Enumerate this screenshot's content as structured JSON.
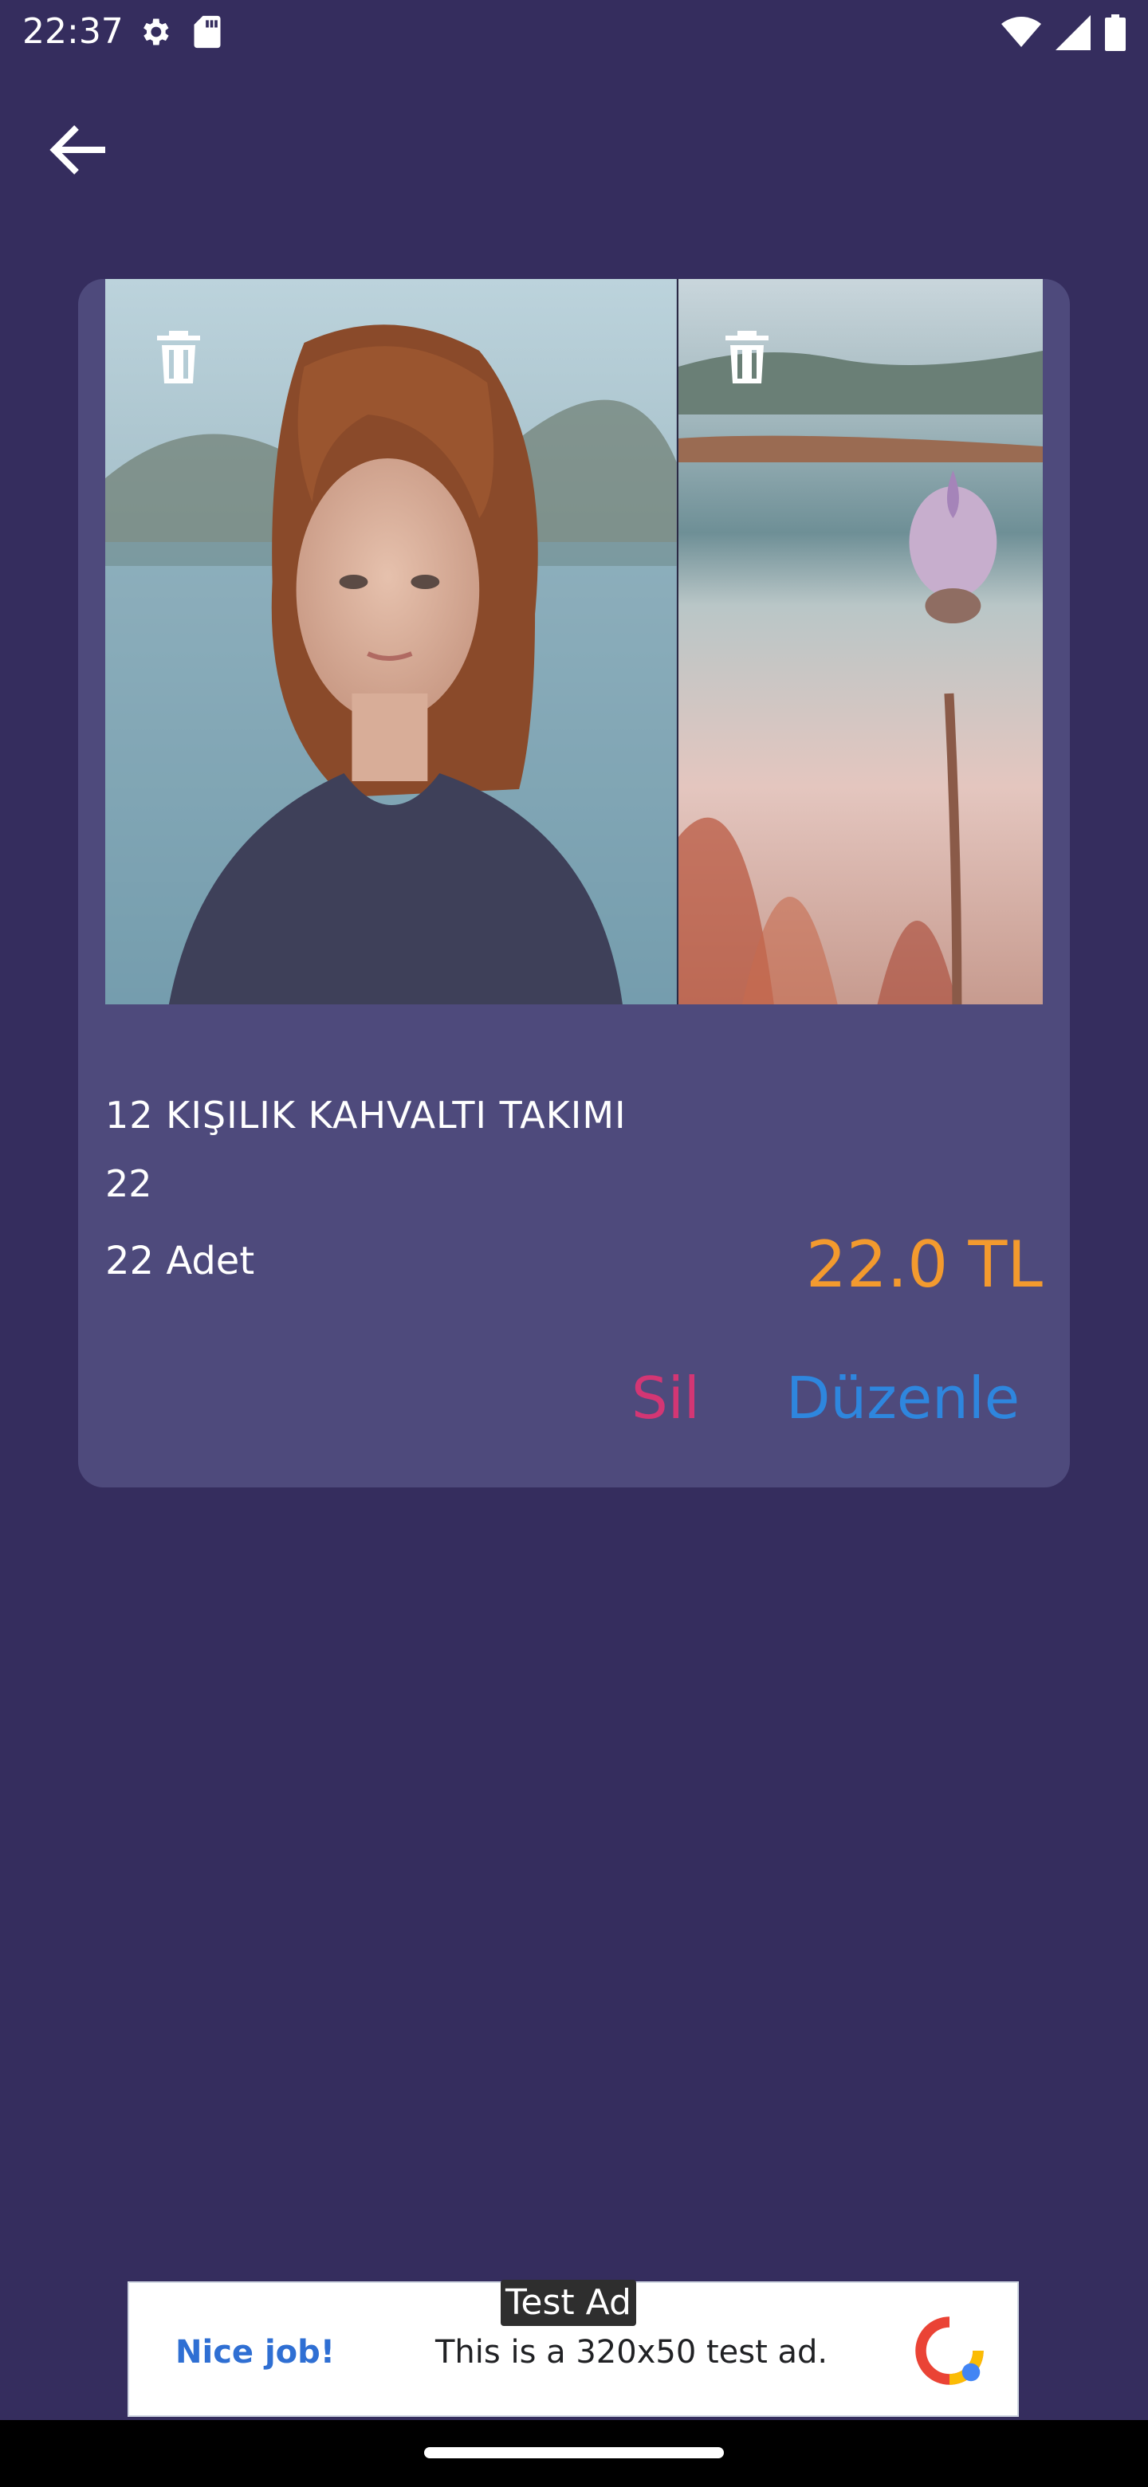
{
  "status_bar": {
    "time": "22:37",
    "left_icons": [
      "gear-icon",
      "sd-card-icon"
    ],
    "right_icons": [
      "wifi-icon",
      "signal-icon",
      "battery-icon"
    ]
  },
  "toolbar": {
    "back_icon": "arrow-left-icon"
  },
  "product": {
    "title": "12 KIŞILIK KAHVALTI TAKIMI",
    "description": "22",
    "quantity": "22 Adet",
    "price": "22.0 TL",
    "delete_label": "Sil",
    "edit_label": "Düzenle",
    "photos": [
      {
        "alt": "woman-portrait-photo",
        "delete_icon": "trash-icon"
      },
      {
        "alt": "flower-lake-photo",
        "delete_icon": "trash-icon"
      }
    ]
  },
  "ad": {
    "tag": "Test Ad",
    "nice": "Nice job!",
    "text": "This is a 320x50 test ad."
  },
  "colors": {
    "background": "#352d5e",
    "card": "#4e4a7c",
    "price": "#f39a2e",
    "delete": "#d33674",
    "edit": "#2e86de"
  }
}
